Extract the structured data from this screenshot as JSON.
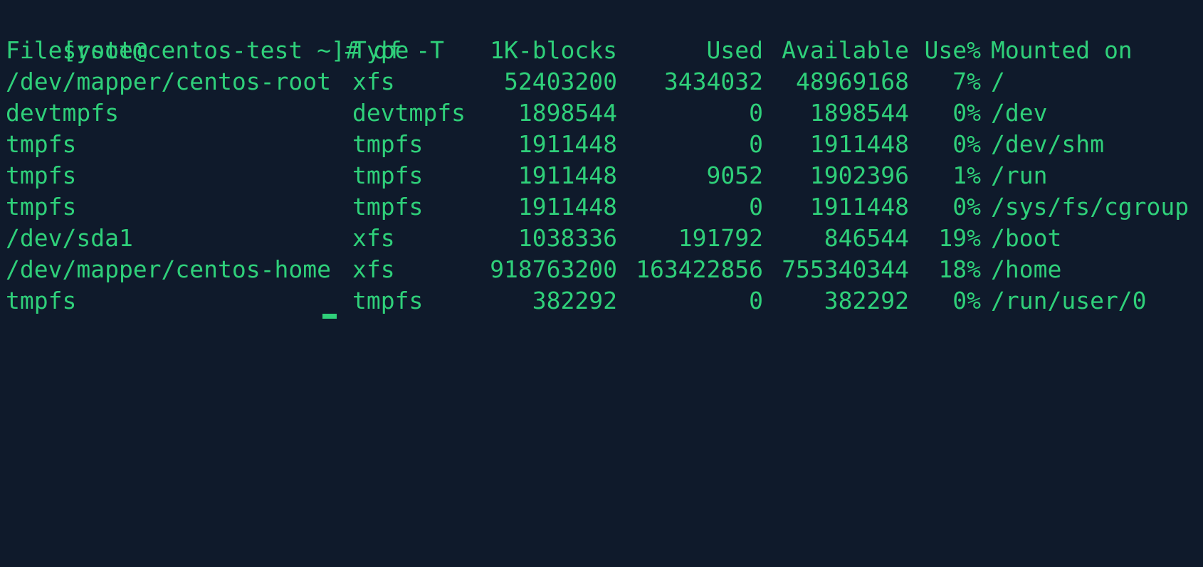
{
  "terminal": {
    "colors": {
      "background": "#0f1a2b",
      "foreground": "#2fd07a"
    },
    "prompt": "[root@centos-test ~]#",
    "command": "df -T",
    "headers": {
      "filesystem": "Filesystem",
      "type": "Type",
      "blocks": "1K-blocks",
      "used": "Used",
      "available": "Available",
      "use_pct": "Use%",
      "mounted": "Mounted on"
    },
    "rows": [
      {
        "filesystem": "/dev/mapper/centos-root",
        "type": "xfs",
        "blocks": "52403200",
        "used": "3434032",
        "available": "48969168",
        "use_pct": "7%",
        "mounted": "/"
      },
      {
        "filesystem": "devtmpfs",
        "type": "devtmpfs",
        "blocks": "1898544",
        "used": "0",
        "available": "1898544",
        "use_pct": "0%",
        "mounted": "/dev"
      },
      {
        "filesystem": "tmpfs",
        "type": "tmpfs",
        "blocks": "1911448",
        "used": "0",
        "available": "1911448",
        "use_pct": "0%",
        "mounted": "/dev/shm"
      },
      {
        "filesystem": "tmpfs",
        "type": "tmpfs",
        "blocks": "1911448",
        "used": "9052",
        "available": "1902396",
        "use_pct": "1%",
        "mounted": "/run"
      },
      {
        "filesystem": "tmpfs",
        "type": "tmpfs",
        "blocks": "1911448",
        "used": "0",
        "available": "1911448",
        "use_pct": "0%",
        "mounted": "/sys/fs/cgroup"
      },
      {
        "filesystem": "/dev/sda1",
        "type": "xfs",
        "blocks": "1038336",
        "used": "191792",
        "available": "846544",
        "use_pct": "19%",
        "mounted": "/boot"
      },
      {
        "filesystem": "/dev/mapper/centos-home",
        "type": "xfs",
        "blocks": "918763200",
        "used": "163422856",
        "available": "755340344",
        "use_pct": "18%",
        "mounted": "/home"
      },
      {
        "filesystem": "tmpfs",
        "type": "tmpfs",
        "blocks": "382292",
        "used": "0",
        "available": "382292",
        "use_pct": "0%",
        "mounted": "/run/user/0"
      }
    ]
  }
}
